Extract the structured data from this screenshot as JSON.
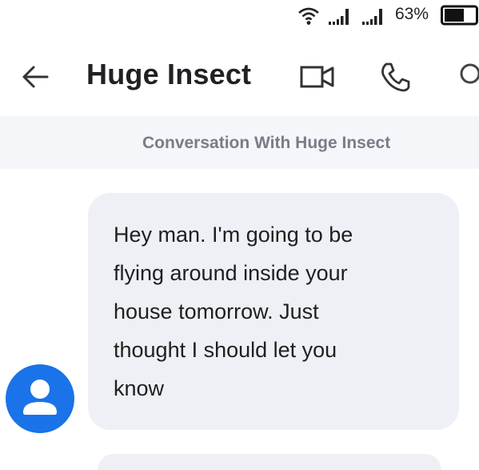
{
  "status_bar": {
    "battery_percent": "63%",
    "icons": [
      "wifi-icon",
      "signal-icon",
      "signal-icon",
      "battery-icon"
    ]
  },
  "header": {
    "title": "Huge Insect",
    "icons": [
      "back-arrow-icon",
      "video-call-icon",
      "phone-icon",
      "search-icon"
    ]
  },
  "banner": {
    "text": "Conversation With Huge Insect"
  },
  "messages": [
    {
      "sender": "contact",
      "text": "Hey man. I'm going to be\nflying around inside your\nhouse tomorrow. Just\nthought I should let you\nknow"
    }
  ],
  "colors": {
    "avatar": "#1a73e8",
    "bubble": "#eef0f5",
    "banner": "#f5f6fa",
    "banner_text": "#787d86"
  }
}
